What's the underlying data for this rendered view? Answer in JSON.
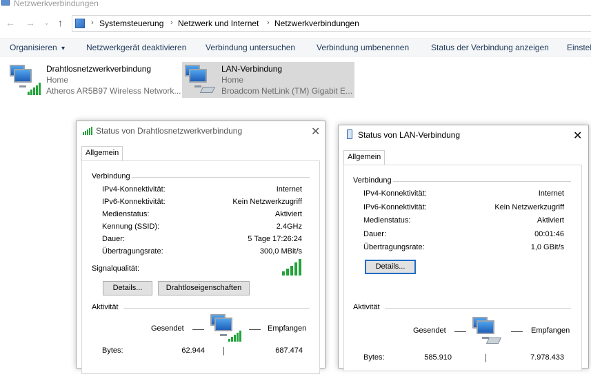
{
  "window": {
    "title": "Netzwerkverbindungen"
  },
  "address": {
    "crumbs": [
      "Systemsteuerung",
      "Netzwerk und Internet",
      "Netzwerkverbindungen"
    ]
  },
  "toolbar": {
    "organize": "Organisieren",
    "organize_arrow": "▾",
    "disable": "Netzwerkgerät deaktivieren",
    "diagnose": "Verbindung untersuchen",
    "rename": "Verbindung umbenennen",
    "status": "Status der Verbindung anzeigen",
    "settings": "Einstel"
  },
  "connections": [
    {
      "name": "Drahtlosnetzwerkverbindung",
      "network": "Home",
      "adapter": "Atheros AR5B97 Wireless Network..."
    },
    {
      "name": "LAN-Verbindung",
      "network": "Home",
      "adapter": "Broadcom NetLink (TM) Gigabit E..."
    }
  ],
  "wifi_dialog": {
    "title": "Status von Drahtlosnetzwerkverbindung",
    "tab": "Allgemein",
    "section_connection": "Verbindung",
    "rows": [
      {
        "label": "IPv4-Konnektivität:",
        "value": "Internet"
      },
      {
        "label": "IPv6-Konnektivität:",
        "value": "Kein Netzwerkzugriff"
      },
      {
        "label": "Medienstatus:",
        "value": "Aktiviert"
      },
      {
        "label": "Kennung (SSID):",
        "value": "2.4GHz"
      },
      {
        "label": "Dauer:",
        "value": "5 Tage 17:26:24"
      },
      {
        "label": "Übertragungsrate:",
        "value": "300,0 MBit/s"
      }
    ],
    "signal_label": "Signalqualität:",
    "details_button": "Details...",
    "wireless_props_button": "Drahtloseigenschaften",
    "section_activity": "Aktivität",
    "sent": "Gesendet",
    "received": "Empfangen",
    "bytes_label": "Bytes:",
    "bytes_sent": "62.944",
    "bytes_received": "687.474"
  },
  "lan_dialog": {
    "title": "Status von LAN-Verbindung",
    "tab": "Allgemein",
    "section_connection": "Verbindung",
    "rows": [
      {
        "label": "IPv4-Konnektivität:",
        "value": "Internet"
      },
      {
        "label": "IPv6-Konnektivität:",
        "value": "Kein Netzwerkzugriff"
      },
      {
        "label": "Medienstatus:",
        "value": "Aktiviert"
      },
      {
        "label": "Dauer:",
        "value": "00:01:46"
      },
      {
        "label": "Übertragungsrate:",
        "value": "1,0 GBit/s"
      }
    ],
    "details_button": "Details...",
    "section_activity": "Aktivität",
    "sent": "Gesendet",
    "received": "Empfangen",
    "bytes_label": "Bytes:",
    "bytes_sent": "585.910",
    "bytes_received": "7.978.433"
  },
  "glyphs": {
    "back": "←",
    "forward": "→",
    "history": "⌄",
    "up": "↑",
    "separator": "›",
    "close": "✕"
  },
  "colors": {
    "signal_green": "#23a33a",
    "focus_blue": "#1f6cc8",
    "selection": "#d9d9d9"
  }
}
